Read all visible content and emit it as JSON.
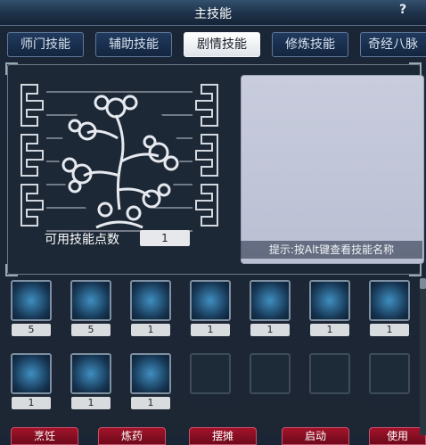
{
  "window": {
    "title": "主技能",
    "help_label": "?"
  },
  "tabs": [
    {
      "label": "师门技能"
    },
    {
      "label": "辅助技能"
    },
    {
      "label": "剧情技能",
      "active": true
    },
    {
      "label": "修炼技能"
    },
    {
      "label": "奇经八脉"
    }
  ],
  "skill_points": {
    "label": "可用技能点数",
    "value": "1"
  },
  "info_panel": {
    "hint": "提示:按Alt键查看技能名称"
  },
  "skills_row1": [
    {
      "icon": "skill-slash-icon",
      "value": "5"
    },
    {
      "icon": "skill-burst-icon",
      "value": "5"
    },
    {
      "icon": "skill-beast-icon",
      "value": "1"
    },
    {
      "icon": "skill-table-icon",
      "value": "1"
    },
    {
      "icon": "skill-scissors-icon",
      "value": "1"
    },
    {
      "icon": "skill-crossed-swords-icon",
      "value": "1"
    },
    {
      "icon": "skill-shield-sword-icon",
      "value": "1"
    }
  ],
  "skills_row2": [
    {
      "icon": "skill-wings-icon",
      "value": "1"
    },
    {
      "icon": "skill-armor-icon",
      "value": "1"
    },
    {
      "icon": "skill-temple-icon",
      "value": "1"
    },
    {
      "icon": "empty-slot-icon"
    },
    {
      "icon": "empty-slot-icon"
    },
    {
      "icon": "empty-slot-icon"
    },
    {
      "icon": "empty-slot-icon"
    }
  ],
  "bottom_buttons": [
    {
      "label": "烹饪"
    },
    {
      "label": "炼药"
    },
    {
      "label": "摆摊"
    },
    {
      "label": "启动"
    },
    {
      "label": "使用"
    }
  ],
  "colors": {
    "accent_tab": "#ffffff",
    "button": "#8a0f22",
    "panel_bg": "#1d2836",
    "info_bg": "#c3c7da"
  }
}
